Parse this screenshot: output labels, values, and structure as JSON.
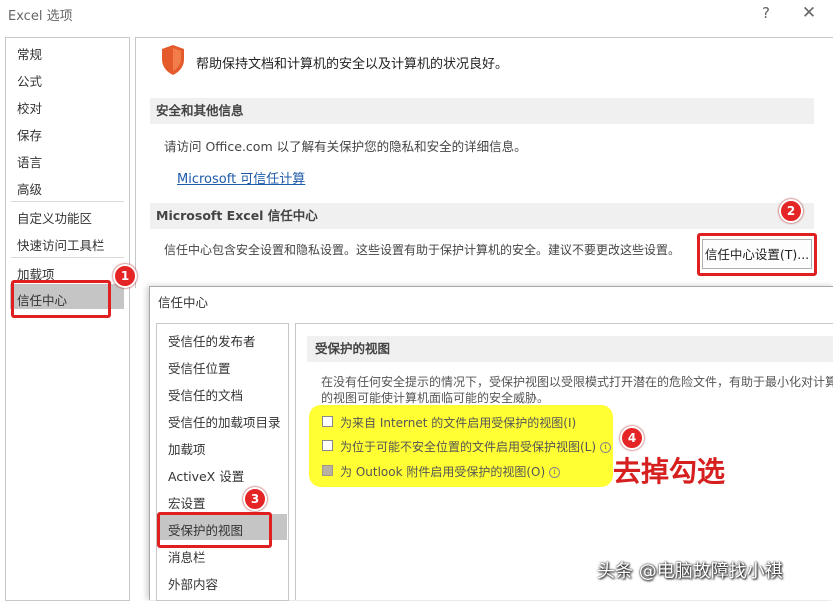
{
  "window": {
    "title": "Excel 选项",
    "help_label": "?",
    "close_label": "✕"
  },
  "sidebar": {
    "items": [
      {
        "label": "常规"
      },
      {
        "label": "公式"
      },
      {
        "label": "校对"
      },
      {
        "label": "保存"
      },
      {
        "label": "语言"
      },
      {
        "label": "高级"
      },
      {
        "label": "自定义功能区"
      },
      {
        "label": "快速访问工具栏"
      },
      {
        "label": "加载项"
      },
      {
        "label": "信任中心"
      }
    ],
    "selected": "信任中心"
  },
  "main": {
    "intro": "帮助保持文档和计算机的安全以及计算机的状况良好。",
    "privacy_header": "安全和其他信息",
    "privacy_text": "请访问 Office.com  以了解有关保护您的隐私和安全的详细信息。",
    "privacy_link": "Microsoft 可信任计算",
    "trust_header": "Microsoft Excel 信任中心",
    "trust_text": "信任中心包含安全设置和隐私设置。这些设置有助于保护计算机的安全。建议不要更改这些设置。",
    "trust_button": "信任中心设置(T)..."
  },
  "trust_center": {
    "title": "信任中心",
    "items": [
      {
        "label": "受信任的发布者"
      },
      {
        "label": "受信任位置"
      },
      {
        "label": "受信任的文档"
      },
      {
        "label": "受信任的加载项目录"
      },
      {
        "label": "加载项"
      },
      {
        "label": "ActiveX 设置"
      },
      {
        "label": "宏设置"
      },
      {
        "label": "受保护的视图"
      },
      {
        "label": "消息栏"
      },
      {
        "label": "外部内容"
      }
    ],
    "selected": "受保护的视图",
    "section_header": "受保护的视图",
    "desc_line1": "在没有任何安全提示的情况下，受保护视图以受限模式打开潜在的危险文件，有助于最小化对计算",
    "desc_line2": "的视图可能使计算机面临可能的安全威胁。",
    "options": [
      {
        "label": "为来自 Internet 的文件启用受保护的视图(I)",
        "checked": false,
        "enabled": true
      },
      {
        "label": "为位于可能不安全位置的文件启用受保护视图(L)",
        "checked": false,
        "enabled": true
      },
      {
        "label": "为 Outlook 附件启用受保护的视图(O)",
        "checked": false,
        "enabled": false
      }
    ]
  },
  "annotations": {
    "badges": [
      "1",
      "2",
      "3",
      "4"
    ],
    "remove_check": "去掉勾选",
    "watermark": "头条 @电脑故障找小祺",
    "box_color": "#e02020",
    "highlight_color": "#ffff33"
  }
}
